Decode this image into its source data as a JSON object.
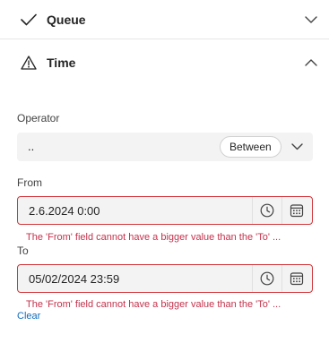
{
  "sections": {
    "queue": {
      "title": "Queue",
      "icon": "checkmark-icon",
      "expanded": false
    },
    "time": {
      "title": "Time",
      "icon": "warning-icon",
      "expanded": true
    }
  },
  "operator": {
    "label": "Operator",
    "value": "..",
    "badge": "Between"
  },
  "from": {
    "label": "From",
    "value": "2.6.2024 0:00",
    "error": "The 'From' field cannot have a bigger value than the 'To' ..."
  },
  "to": {
    "label": "To",
    "value": "05/02/2024 23:59",
    "error": "The 'From' field cannot have a bigger value than the 'To' ..."
  },
  "clear_label": "Clear",
  "colors": {
    "error": "#c4314b",
    "link": "#0f6cbd",
    "input_bg": "#f3f3f3"
  }
}
